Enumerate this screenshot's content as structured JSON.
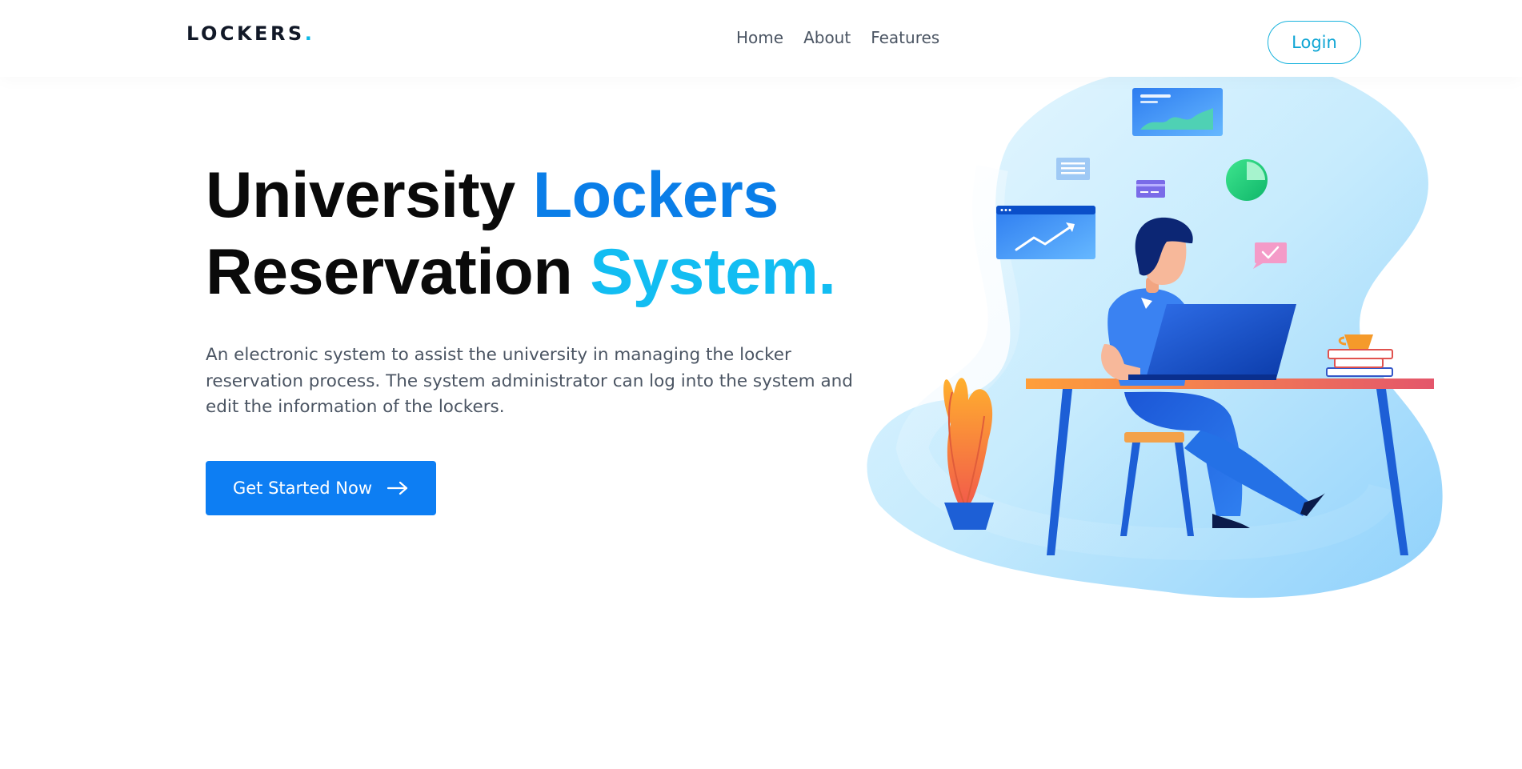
{
  "header": {
    "logo_text": "LOCKERS",
    "logo_dot": ".",
    "nav": [
      {
        "label": "Home"
      },
      {
        "label": "About"
      },
      {
        "label": "Features"
      }
    ],
    "login_label": "Login"
  },
  "hero": {
    "title_line1_black": "University ",
    "title_line1_accent": "Lockers",
    "title_line2_black": "Reservation ",
    "title_line2_accent": "System.",
    "description": "An electronic system to assist the university in managing the locker reservation process. The system administrator can log into the system and edit the information of the lockers.",
    "cta_label": "Get Started Now",
    "cta_icon": "arrow-right-icon"
  },
  "illustration": {
    "subject": "person-working-at-laptop-illustration"
  },
  "colors": {
    "primary": "#0d7ef3",
    "accent_blue": "#0a7ee8",
    "accent_cyan": "#12bdf2",
    "login_border": "#18b3dd",
    "text_dark": "#0a0a0a",
    "text_muted": "#4b5563"
  }
}
